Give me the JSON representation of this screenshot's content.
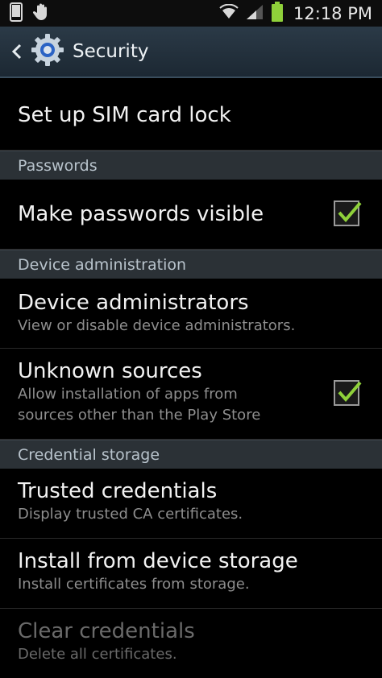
{
  "status_bar": {
    "time": "12:18 PM"
  },
  "action_bar": {
    "title": "Security"
  },
  "items": {
    "sim_lock": {
      "title": "Set up SIM card lock"
    },
    "passwords_header": "Passwords",
    "passwords_visible": {
      "title": "Make passwords visible",
      "checked": true
    },
    "device_admin_header": "Device administration",
    "device_admins": {
      "title": "Device administrators",
      "summary": "View or disable device administrators."
    },
    "unknown_sources": {
      "title": "Unknown sources",
      "summary_line1": "Allow installation of apps from",
      "summary_line2": "sources other than the Play Store",
      "checked": true
    },
    "credential_header": "Credential storage",
    "trusted_credentials": {
      "title": "Trusted credentials",
      "summary": "Display trusted CA certificates."
    },
    "install_storage": {
      "title": "Install from device storage",
      "summary": "Install certificates from storage."
    },
    "clear_credentials": {
      "title": "Clear credentials",
      "summary": "Delete all certificates.",
      "enabled": false
    }
  },
  "colors": {
    "check_green": "#8fd13a",
    "section_bg": "#2b3136",
    "actionbar_bg": "#1f2b36"
  },
  "icons": [
    "phone-icon",
    "hand-icon",
    "wifi-icon",
    "signal-icon",
    "battery-icon",
    "back-arrow-icon",
    "gear-icon",
    "check-icon"
  ]
}
